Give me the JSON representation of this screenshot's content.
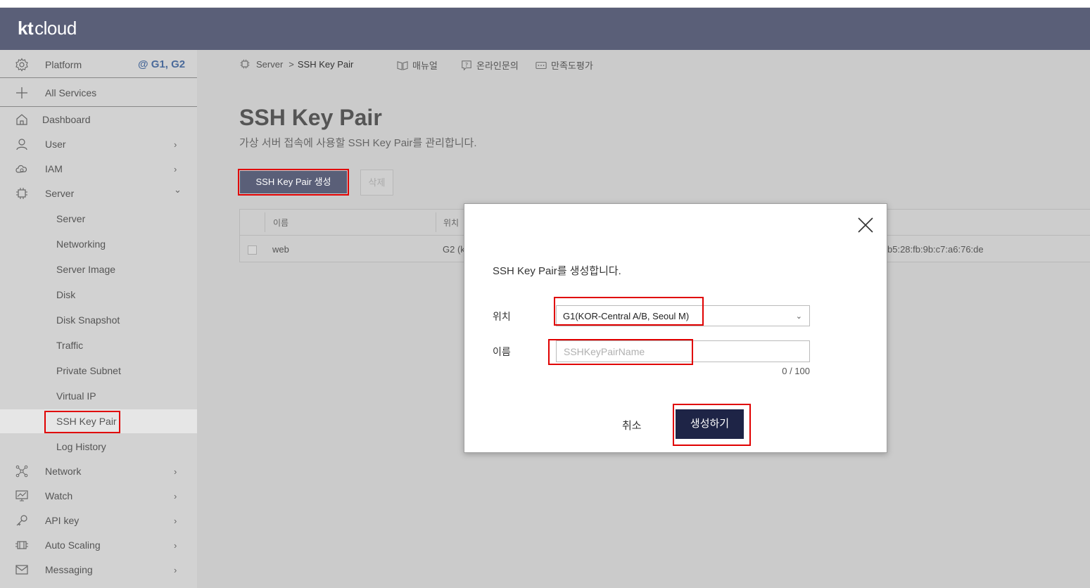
{
  "brand": {
    "kt": "kt",
    "cloud": "cloud"
  },
  "sidebar": {
    "platform": {
      "label": "Platform",
      "region": "@ G1, G2",
      "icon": "gear-icon"
    },
    "all_services": {
      "label": "All Services",
      "icon": "plus-icon"
    },
    "items": [
      {
        "label": "Dashboard",
        "icon": "home-icon"
      },
      {
        "label": "User",
        "icon": "user-icon",
        "chevron": "›"
      },
      {
        "label": "IAM",
        "icon": "cloud-icon",
        "chevron": "›"
      },
      {
        "label": "Server",
        "icon": "chip-icon",
        "chevron": "⌄"
      }
    ],
    "server_sub": [
      "Server",
      "Networking",
      "Server Image",
      "Disk",
      "Disk Snapshot",
      "Traffic",
      "Private Subnet",
      "Virtual IP",
      "SSH Key Pair",
      "Log History"
    ],
    "active_sub": "SSH Key Pair",
    "bottom_items": [
      {
        "label": "Network",
        "icon": "network-icon",
        "chevron": "›"
      },
      {
        "label": "Watch",
        "icon": "monitor-icon",
        "chevron": "›"
      },
      {
        "label": "API key",
        "icon": "key-icon",
        "chevron": "›"
      },
      {
        "label": "Auto Scaling",
        "icon": "scaling-icon",
        "chevron": "›"
      },
      {
        "label": "Messaging",
        "icon": "mail-icon",
        "chevron": "›"
      }
    ]
  },
  "breadcrumb": {
    "parent": "Server",
    "separator": ">",
    "current": "SSH Key Pair"
  },
  "toplinks": {
    "manual": "매뉴얼",
    "inquiry": "온라인문의",
    "survey": "만족도평가"
  },
  "page": {
    "title": "SSH Key Pair",
    "description": "가상 서버 접속에 사용할 SSH Key Pair를 관리합니다.",
    "create_button": "SSH Key Pair 생성",
    "delete_button": "삭제"
  },
  "table": {
    "headers": [
      "이름",
      "위치"
    ],
    "rows": [
      {
        "name": "web",
        "location_partial": "G2 (k",
        "fingerprint_partial": "b5:28:fb:9b:c7:a6:76:de"
      }
    ]
  },
  "modal": {
    "message": "SSH Key Pair를 생성합니다.",
    "location_label": "위치",
    "location_value": "G1(KOR-Central A/B, Seoul M)",
    "name_label": "이름",
    "name_placeholder": "SSHKeyPairName",
    "name_value": "",
    "counter": "0 / 100",
    "cancel": "취소",
    "confirm": "생성하기"
  },
  "colors": {
    "header": "#5a5f78",
    "highlight": "#e00000",
    "confirm": "#1e2446",
    "region": "#4a6a9a"
  }
}
